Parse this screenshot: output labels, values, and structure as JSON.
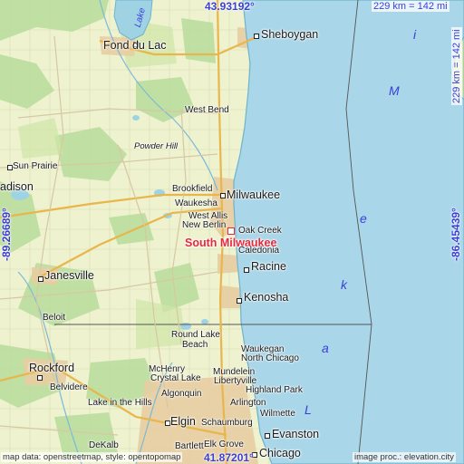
{
  "map": {
    "highlight": {
      "name": "South Milwaukee"
    },
    "coordinates": {
      "top": "43.93192°",
      "bottom": "41.87201°",
      "left": "-89.26689°",
      "right": "-86.45439°"
    },
    "scale": {
      "top": "229 km = 142 mi",
      "right": "229 km = 142 mi"
    },
    "lake_letters": [
      "L",
      "a",
      "k",
      "e",
      "M",
      "i"
    ],
    "small_lake_label": "Lake",
    "cities": {
      "fond_du_lac": "Fond du Lac",
      "sheboygan": "Sheboygan",
      "west_bend": "West Bend",
      "powder_hill": "Powder Hill",
      "sun_prairie": "Sun Prairie",
      "madison": "adison",
      "brookfield": "Brookfield",
      "waukesha": "Waukesha",
      "milwaukee": "Milwaukee",
      "west_allis": "West Allis",
      "new_berlin": "New Berlin",
      "oak_creek": "Oak Creek",
      "caledonia": "Caledonia",
      "janesville": "Janesville",
      "racine": "Racine",
      "kenosha": "Kenosha",
      "beloit": "Beloit",
      "round_lake_beach": "Round Lake",
      "round_lake_beach2": "Beach",
      "waukegan": "Waukegan",
      "north_chicago": "North Chicago",
      "rockford": "Rockford",
      "mchenry": "McHenry",
      "crystal_lake": "Crystal Lake",
      "mundelein": "Mundelein",
      "belvidere": "Belvidere",
      "libertyville": "Libertyville",
      "highland_park": "Highland Park",
      "algonquin": "Algonquin",
      "lake_in_the_hills": "Lake in the Hills",
      "arlington": "Arlington",
      "wilmette": "Wilmette",
      "elgin": "Elgin",
      "schaumburg": "Schaumburg",
      "evanston": "Evanston",
      "dekalb": "DeKalb",
      "bartlett": "Bartlett",
      "elk_grove": "Elk Grove",
      "chicago": "Chicago"
    },
    "credits": {
      "left": "map data: openstreetmap, style: opentopomap",
      "right": "image proc.: elevation.city"
    }
  }
}
